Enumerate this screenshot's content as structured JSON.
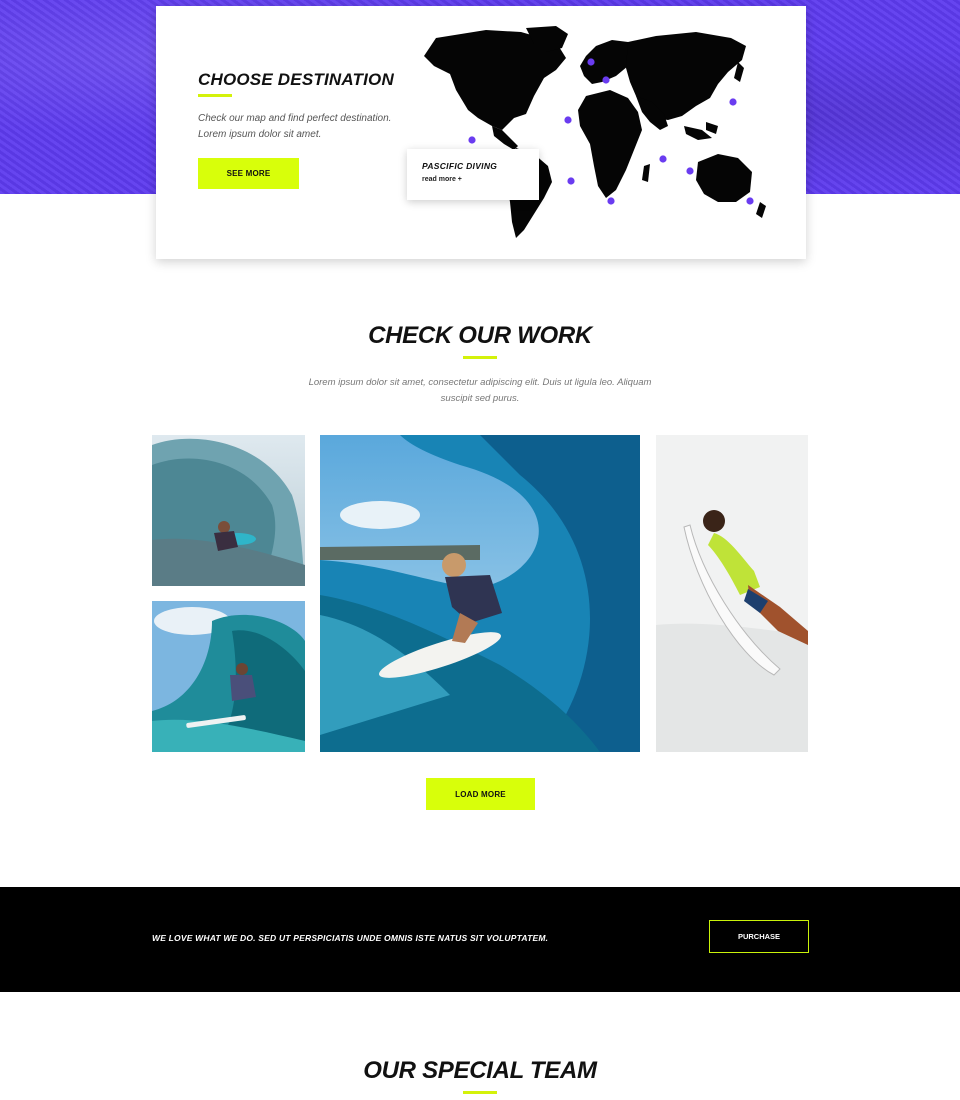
{
  "destination": {
    "title": "CHOOSE DESTINATION",
    "description": "Check our map and find perfect destination. Lorem ipsum dolor sit amet.",
    "button_label": "SEE MORE",
    "popup_title": "PASCIFIC DIVING",
    "popup_link": "read more +",
    "pin_color": "#6a3cf0"
  },
  "work": {
    "title": "CHECK OUR WORK",
    "description": "Lorem ipsum dolor sit amet, consectetur adipiscing elit. Duis ut ligula leo. Aliquam suscipit sed purus.",
    "load_more_label": "LOAD MORE"
  },
  "cta": {
    "text": "WE LOVE WHAT WE DO. SED UT PERSPICIATIS UNDE OMNIS ISTE NATUS SIT VOLUPTATEM.",
    "button_label": "PURCHASE"
  },
  "team": {
    "title": "OUR SPECIAL TEAM"
  },
  "colors": {
    "accent": "#d8ff0a",
    "hero": "#5e3bef",
    "dark": "#000000"
  }
}
